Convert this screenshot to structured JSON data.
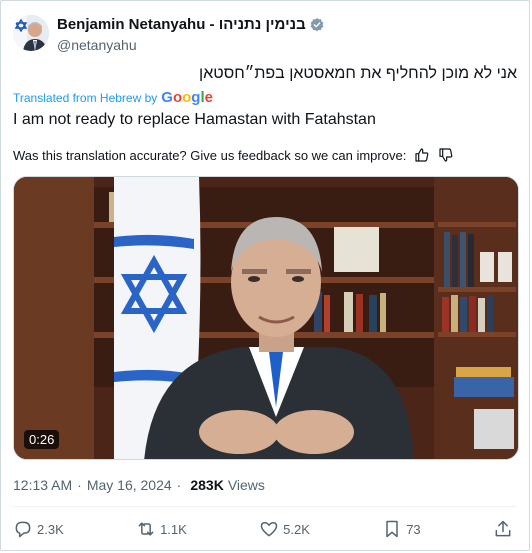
{
  "author": {
    "display_name": "Benjamin Netanyahu - בנימין נתניהו",
    "handle": "@netanyahu",
    "verified": true
  },
  "tweet": {
    "original_text": "אני לא מוכן להחליף את חמאסטאן בפת״חסטאן",
    "translated_prefix": "Translated from Hebrew by",
    "translation_provider": "Google",
    "translated_text": "I am not ready to replace Hamastan with Fatahstan",
    "feedback_prompt": "Was this translation accurate? Give us feedback so we can improve:"
  },
  "media": {
    "duration": "0:26"
  },
  "meta": {
    "time": "12:13 AM",
    "separator": "·",
    "date": "May 16, 2024",
    "views_count": "283K",
    "views_label": "Views"
  },
  "actions": {
    "replies": "2.3K",
    "reposts": "1.1K",
    "likes": "5.2K",
    "bookmarks": "73"
  },
  "colors": {
    "link_blue": "#1d9bf0",
    "text_secondary": "#536471",
    "text_primary": "#0f1419",
    "border": "#cfd9de"
  },
  "icons": [
    "verified-badge-icon",
    "thumbs-up-icon",
    "thumbs-down-icon",
    "reply-icon",
    "repost-icon",
    "like-icon",
    "bookmark-icon",
    "share-icon"
  ]
}
